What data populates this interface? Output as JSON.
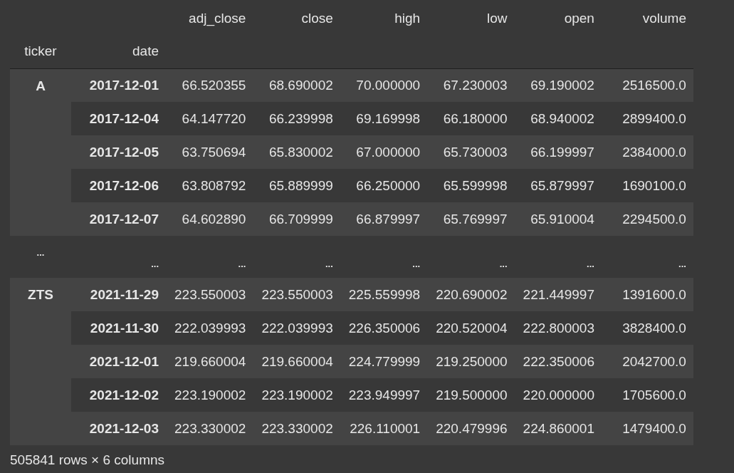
{
  "table": {
    "columns": [
      "adj_close",
      "close",
      "high",
      "low",
      "open",
      "volume"
    ],
    "index_names": [
      "ticker",
      "date"
    ],
    "rows": [
      {
        "kind": "data",
        "ticker": "A",
        "date": "2017-12-01",
        "values": [
          "66.520355",
          "68.690002",
          "70.000000",
          "67.230003",
          "69.190002",
          "2516500.0"
        ]
      },
      {
        "kind": "data",
        "date": "2017-12-04",
        "values": [
          "64.147720",
          "66.239998",
          "69.169998",
          "66.180000",
          "68.940002",
          "2899400.0"
        ]
      },
      {
        "kind": "data",
        "date": "2017-12-05",
        "values": [
          "63.750694",
          "65.830002",
          "67.000000",
          "65.730003",
          "66.199997",
          "2384000.0"
        ]
      },
      {
        "kind": "data",
        "date": "2017-12-06",
        "values": [
          "63.808792",
          "65.889999",
          "66.250000",
          "65.599998",
          "65.879997",
          "1690100.0"
        ]
      },
      {
        "kind": "data",
        "date": "2017-12-07",
        "values": [
          "64.602890",
          "66.709999",
          "66.879997",
          "65.769997",
          "65.910004",
          "2294500.0"
        ]
      },
      {
        "kind": "ellipsis",
        "ticker": "...",
        "date": "...",
        "values": [
          "...",
          "...",
          "...",
          "...",
          "...",
          "..."
        ]
      },
      {
        "kind": "data",
        "ticker": "ZTS",
        "date": "2021-11-29",
        "values": [
          "223.550003",
          "223.550003",
          "225.559998",
          "220.690002",
          "221.449997",
          "1391600.0"
        ]
      },
      {
        "kind": "data",
        "date": "2021-11-30",
        "values": [
          "222.039993",
          "222.039993",
          "226.350006",
          "220.520004",
          "222.800003",
          "3828400.0"
        ]
      },
      {
        "kind": "data",
        "date": "2021-12-01",
        "values": [
          "219.660004",
          "219.660004",
          "224.779999",
          "219.250000",
          "222.350006",
          "2042700.0"
        ]
      },
      {
        "kind": "data",
        "date": "2021-12-02",
        "values": [
          "223.190002",
          "223.190002",
          "223.949997",
          "219.500000",
          "220.000000",
          "1705600.0"
        ]
      },
      {
        "kind": "data",
        "date": "2021-12-03",
        "values": [
          "223.330002",
          "223.330002",
          "226.110001",
          "220.479996",
          "224.860001",
          "1479400.0"
        ]
      }
    ]
  },
  "summary": "505841 rows × 6 columns"
}
